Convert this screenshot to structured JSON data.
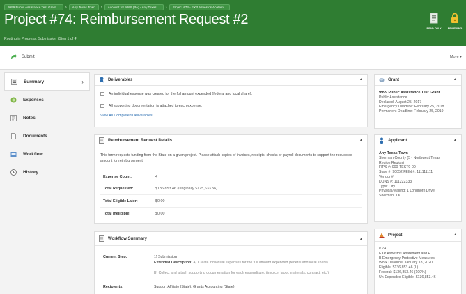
{
  "header": {
    "breadcrumbs": [
      "9999 Public Assistance Test Grant ...",
      "Any Texas Town",
      "Account for 9999 (PA) - Any Texas ...",
      "Project #74 - EXP Asbestos Abatem..."
    ],
    "title": "Project #74: Reimbursement Request #2",
    "routing": "Routing in Progress: Submission (Step 1 of 4)",
    "readonly_label": "READ-ONLY",
    "reviewing_label": "REVIEWING",
    "color": "#2f7d32"
  },
  "toolbar": {
    "submit_label": "Submit",
    "more_label": "More"
  },
  "sidebar": {
    "items": [
      {
        "label": "Summary",
        "icon": "list-icon"
      },
      {
        "label": "Expenses",
        "icon": "money-icon"
      },
      {
        "label": "Notes",
        "icon": "notes-icon"
      },
      {
        "label": "Documents",
        "icon": "document-icon"
      },
      {
        "label": "Workflow",
        "icon": "workflow-icon"
      },
      {
        "label": "History",
        "icon": "history-icon"
      }
    ]
  },
  "deliverables": {
    "title": "Deliverables",
    "items": [
      "An individual expense was created for the full amount expended (federal and local share).",
      "All supporting documentation is attached to each expense."
    ],
    "view_link": "View All Completed Deliverables"
  },
  "request": {
    "title": "Reimbursement Request Details",
    "description": "This form requests funding from the State on a given project. Please attach copies of invoices, receipts, checks or payroll documents to support the requested amount for reimbursement.",
    "rows": [
      {
        "label": "Expense Count:",
        "value": "4"
      },
      {
        "label": "Total Requested:",
        "value": "$136,853.46 (Originally $175,633.56)"
      },
      {
        "label": "Total Eligible Later:",
        "value": "$0.00"
      },
      {
        "label": "Total Ineligible:",
        "value": "$0.00"
      }
    ]
  },
  "workflow": {
    "title": "Workflow Summary",
    "current_step_label": "Current Step:",
    "step1": "1) Submission",
    "ext_label": "Extended Description:",
    "ext_text": "A) Create individual expenses for the full amount expended (federal and local share).",
    "step_b": "B) Collect and attach supporting documentation for each expenditure. (invoice, labor, materials, contract, etc.)",
    "recipients_label": "Recipients:",
    "recipients_value": "Support Affiliate (State), Grants Accounting (State)"
  },
  "grant": {
    "title": "Grant",
    "lines": [
      "9999 Public Assistance Test Grant",
      "Public Assistance",
      "Declared: August 25, 2017",
      "Emergency Deadline: February 25, 2018",
      "Permanent Deadline: February 25, 2019"
    ]
  },
  "applicant": {
    "title": "Applicant",
    "lines": [
      "Any Texas Town",
      "Sherman County (5 - Northwest Texas",
      "Region Region)",
      "FIPS #: 000-TEST0-00",
      "State #: 90052 FEIN #: 111111111",
      "Vendor #:",
      "DUNS #: 111222333",
      "Type: City",
      "Physical/Mailing: 1 Longhorn Drive",
      "Sherman, TX."
    ]
  },
  "project": {
    "title": "Project",
    "lines": [
      "# 74",
      "EXP Asbestos Abatement and E",
      "B Emergency Protective Measures",
      "Work Deadline: January 18, 2020",
      "Eligible: $136,853.46 (L)",
      "Federal: $136,853.46 (100%)",
      "Un-Expended Eligible: $136,853.46"
    ]
  }
}
